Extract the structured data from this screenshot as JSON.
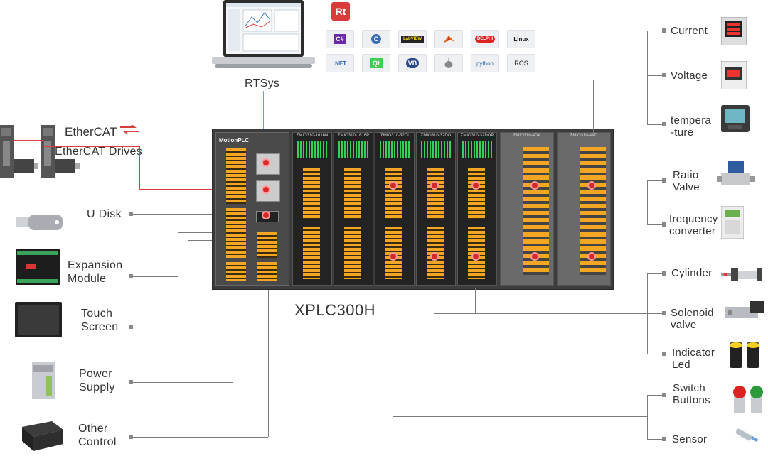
{
  "title": "XPLC300H",
  "software": {
    "label": "RTSys",
    "logo_text": "Rt",
    "tools": [
      "C#",
      "C",
      "LabVIEW",
      "MATLAB",
      "DELPHI",
      "Linux",
      ".NET",
      "Qt",
      "VB",
      "",
      "python",
      "ROS"
    ]
  },
  "ethercat": {
    "logo": "EtherCAT",
    "drives_label": "EtherCAT Drives"
  },
  "left_items": [
    "U Disk",
    "Expansion\nModule",
    "Touch\nScreen",
    "Power\nSupply",
    "Other\nControl"
  ],
  "right_items": [
    "Current",
    "Voltage",
    "tempera\n-ture",
    "Ratio\nValve",
    "frequency\nconverter",
    "Cylinder",
    "Solenoid\nvalve",
    "Indicator\nLed",
    "Switch\nButtons",
    "Sensor"
  ],
  "plc": {
    "cpu_label": "MotionPLC",
    "modules": [
      "ZMIO310-1616N",
      "ZMIO310-1616P",
      "ZMIO310-32DI",
      "ZMIO310-32DO",
      "ZMIO310-32DOP",
      "ZMIO310-4DA",
      "ZMIO310-4AD"
    ]
  },
  "colors": {
    "line": "#7a7a7a",
    "ethercat_red": "#d84040",
    "rtsys_blue": "#5aa7d8",
    "terminal": "#f2a623"
  }
}
